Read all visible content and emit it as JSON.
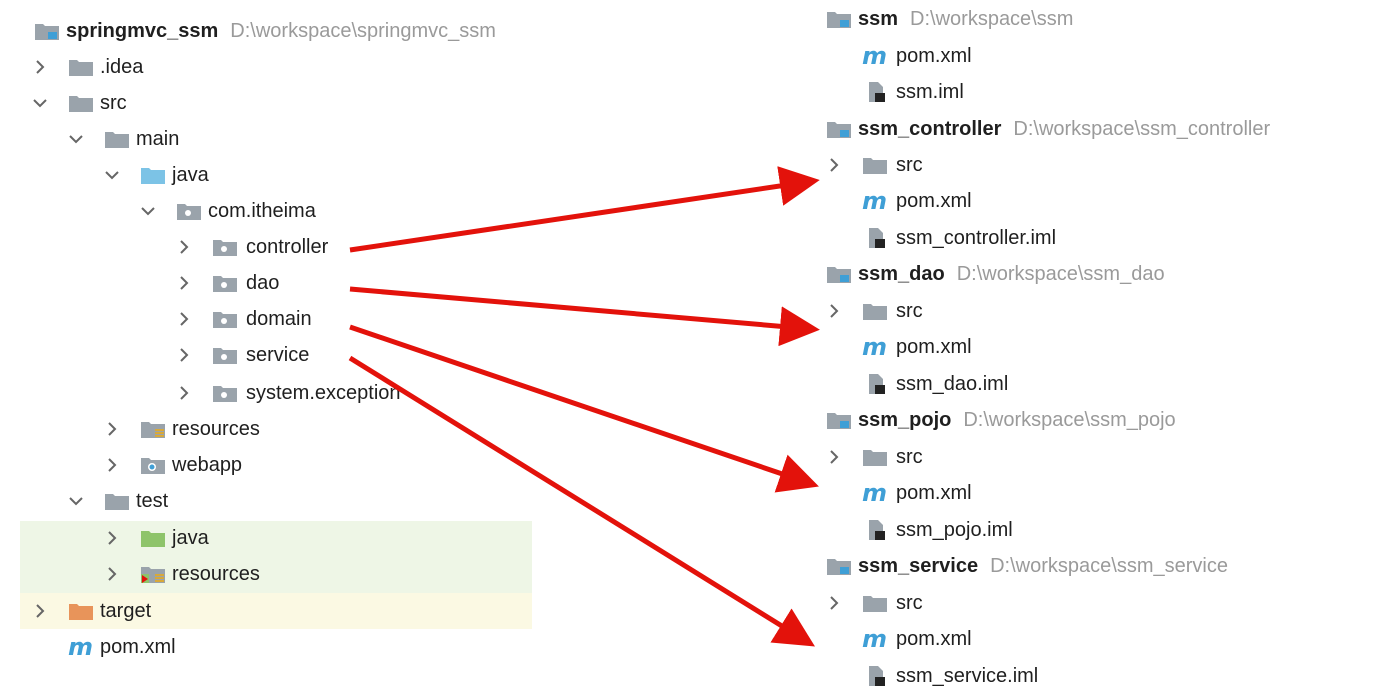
{
  "left_tree": {
    "project": {
      "name": "springmvc_ssm",
      "path": "D:\\workspace\\springmvc_ssm"
    },
    "items": [
      {
        "label": ".idea",
        "icon": "folder-icon"
      },
      {
        "label": "src",
        "icon": "folder-icon"
      },
      {
        "label": "main",
        "icon": "folder-icon"
      },
      {
        "label": "java",
        "icon": "source-folder-icon"
      },
      {
        "label": "com.itheima",
        "icon": "package-icon"
      },
      {
        "label": "controller",
        "icon": "package-icon"
      },
      {
        "label": "dao",
        "icon": "package-icon"
      },
      {
        "label": "domain",
        "icon": "package-icon"
      },
      {
        "label": "service",
        "icon": "package-icon"
      },
      {
        "label": "system.exception",
        "icon": "package-icon"
      },
      {
        "label": "resources",
        "icon": "resources-folder-icon"
      },
      {
        "label": "webapp",
        "icon": "web-folder-icon"
      },
      {
        "label": "test",
        "icon": "folder-icon"
      },
      {
        "label": "java",
        "icon": "test-source-folder-icon"
      },
      {
        "label": "resources",
        "icon": "test-resources-folder-icon"
      },
      {
        "label": "target",
        "icon": "excluded-folder-icon"
      },
      {
        "label": "pom.xml",
        "icon": "maven-icon"
      }
    ]
  },
  "right_tree": {
    "modules": [
      {
        "name": "ssm",
        "path": "D:\\workspace\\ssm",
        "children": [
          "pom.xml",
          "ssm.iml"
        ]
      },
      {
        "name": "ssm_controller",
        "path": "D:\\workspace\\ssm_controller",
        "children": [
          "src",
          "pom.xml",
          "ssm_controller.iml"
        ]
      },
      {
        "name": "ssm_dao",
        "path": "D:\\workspace\\ssm_dao",
        "children": [
          "src",
          "pom.xml",
          "ssm_dao.iml"
        ]
      },
      {
        "name": "ssm_pojo",
        "path": "D:\\workspace\\ssm_pojo",
        "children": [
          "src",
          "pom.xml",
          "ssm_pojo.iml"
        ]
      },
      {
        "name": "ssm_service",
        "path": "D:\\workspace\\ssm_service",
        "children": [
          "src",
          "pom.xml",
          "ssm_service.iml"
        ]
      }
    ]
  },
  "maven_glyph": "m",
  "colors": {
    "arrow": "#e3120b",
    "folder": "#9aa3ab",
    "source_folder": "#7cc3e6",
    "test_folder": "#8ec46a",
    "target_folder": "#e8945a",
    "maven": "#3f9fd6",
    "path_text": "#9a9a9a"
  }
}
